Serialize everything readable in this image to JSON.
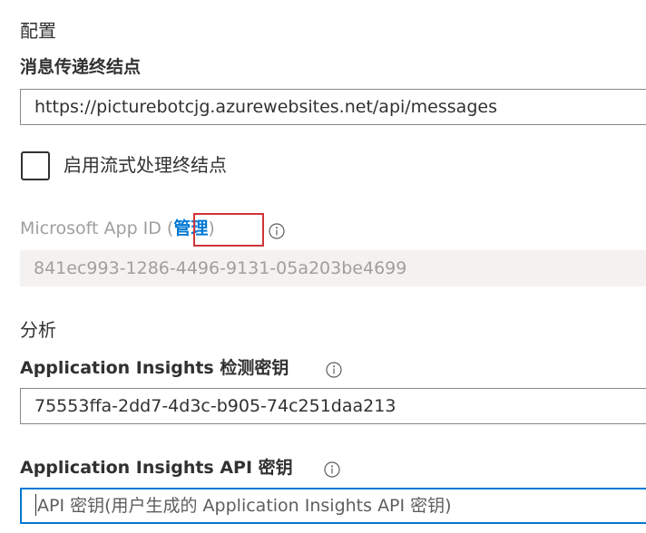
{
  "config_section": {
    "title": "配置"
  },
  "messaging_endpoint": {
    "label": "消息传递终结点",
    "value": "https://picturebotcjg.azurewebsites.net/api/messages"
  },
  "streaming_endpoint": {
    "label": "启用流式处理终结点",
    "checked": false
  },
  "app_id": {
    "label": "Microsoft App ID (",
    "manage_link": "管理",
    "label_close": ")",
    "value": "841ec993-1286-4496-9131-05a203be4699",
    "info_icon": "info-icon"
  },
  "analytics_section": {
    "title": "分析"
  },
  "instrumentation_key": {
    "label": "Application Insights 检测密钥",
    "value": "75553ffa-2dd7-4d3c-b905-74c251daa213",
    "info_icon": "info-icon"
  },
  "api_key": {
    "label": "Application Insights API 密钥",
    "placeholder": "API 密钥(用户生成的 Application Insights API 密钥)",
    "info_icon": "info-icon"
  },
  "colors": {
    "link": "#0078d4",
    "highlight": "#d13438",
    "disabled_text": "#a19f9d",
    "readonly_bg": "#f3f2f1"
  }
}
